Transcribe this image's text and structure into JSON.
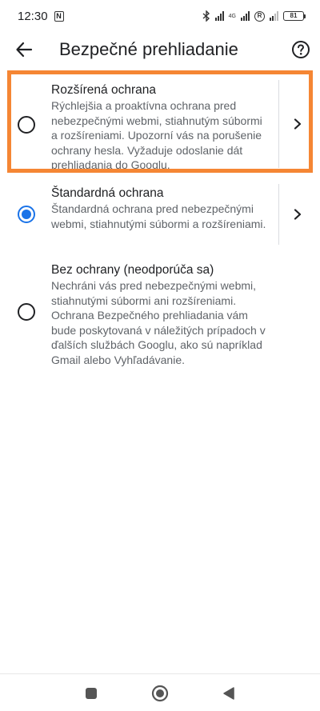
{
  "status_bar": {
    "time": "12:30",
    "network": "4G",
    "roaming_badge": "R",
    "battery": "81"
  },
  "header": {
    "title": "Bezpečné prehliadanie"
  },
  "options": [
    {
      "title": "Rozšírená ochrana",
      "description": "Rýchlejšia a proaktívna ochrana pred nebezpečnými webmi, stiahnutým súbormi a rozšíreniami. Upozorní vás na porušenie ochrany hesla. Vyžaduje odoslanie dát prehliadania do Googlu.",
      "selected": false
    },
    {
      "title": "Štandardná ochrana",
      "description": "Štandardná ochrana pred nebezpečnými webmi, stiahnutými súbormi a rozšíreniami.",
      "selected": true
    },
    {
      "title": "Bez ochrany (neodporúča sa)",
      "description": "Nechráni vás pred nebezpečnými webmi, stiahnutými súbormi ani rozšíreniami. Ochrana Bezpečného prehliadania vám bude poskytovaná v náležitých prípadoch v ďalších službách Googlu, ako sú napríklad Gmail alebo Vyhľadávanie.",
      "selected": false
    }
  ],
  "colors": {
    "accent": "#1a73e8",
    "highlight": "#f58634",
    "secondary_text": "#5f6368"
  },
  "icons": {
    "back": "arrow-back-icon",
    "help": "help-circle-icon",
    "chevron": "chevron-right-icon",
    "nav_recents": "square-icon",
    "nav_home": "circle-icon",
    "nav_back": "triangle-back-icon"
  }
}
